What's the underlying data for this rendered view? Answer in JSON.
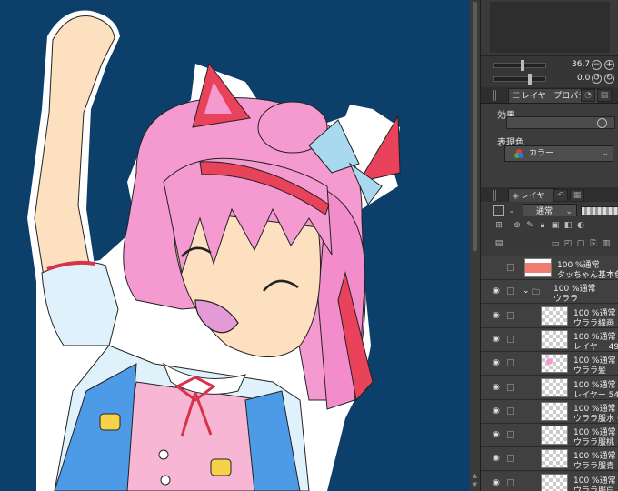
{
  "navigator": {
    "zoom_value": "36.7",
    "rotate_value": "0.0"
  },
  "layer_property": {
    "tab_label": "レイヤープロパティ",
    "effect_label": "効果",
    "expression_color_label": "表現色",
    "expression_color_value": "カラー"
  },
  "layer_panel": {
    "tab_label": "レイヤー",
    "blend_mode": "通常",
    "layers": [
      {
        "line1": "100 %通常",
        "line2": "タッちゃん基本色",
        "thumb": "red",
        "indent": 0
      },
      {
        "line1": "100 %通常",
        "line2": "ウララ",
        "thumb": "folder",
        "indent": 0
      },
      {
        "line1": "100 %通常",
        "line2": "ウララ線画",
        "thumb": "plain",
        "indent": 1
      },
      {
        "line1": "100 %通常",
        "line2": "レイヤー 49",
        "thumb": "plain",
        "indent": 1
      },
      {
        "line1": "100 %通常",
        "line2": "ウララ髪",
        "thumb": "pink",
        "indent": 1
      },
      {
        "line1": "100 %通常",
        "line2": "レイヤー 54",
        "thumb": "plain",
        "indent": 1
      },
      {
        "line1": "100 %通常",
        "line2": "ウララ服水・黄",
        "thumb": "plain",
        "indent": 1
      },
      {
        "line1": "100 %通常",
        "line2": "ウララ服桃",
        "thumb": "plain",
        "indent": 1
      },
      {
        "line1": "100 %通常",
        "line2": "ウララ服青",
        "thumb": "plain",
        "indent": 1
      },
      {
        "line1": "100 %通常",
        "line2": "ウララ服白",
        "thumb": "plain",
        "indent": 1
      }
    ]
  },
  "colors": {
    "canvas_bg": "#0d3f6b",
    "panel_bg": "#3c3c3c",
    "accent_red": "#e8435a"
  }
}
